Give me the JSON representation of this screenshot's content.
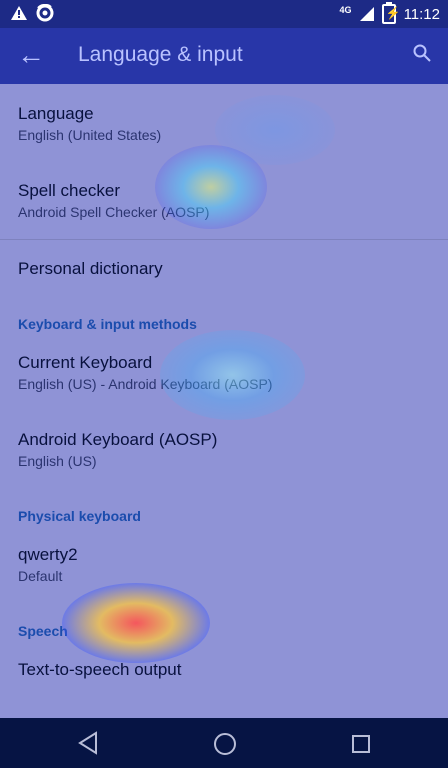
{
  "status_bar": {
    "time": "11:12",
    "network": "4G",
    "icons": [
      "warning-icon",
      "firefox-icon",
      "signal-icon",
      "battery-charging-icon"
    ]
  },
  "app_bar": {
    "title": "Language & input",
    "back_icon": "arrow-back-icon",
    "search_icon": "search-icon"
  },
  "items": {
    "language": {
      "title": "Language",
      "summary": "English (United States)"
    },
    "spell_checker": {
      "title": "Spell checker",
      "summary": "Android Spell Checker (AOSP)"
    },
    "personal_dictionary": {
      "title": "Personal dictionary"
    },
    "current_keyboard": {
      "title": "Current Keyboard",
      "summary": "English (US) - Android Keyboard (AOSP)"
    },
    "android_keyboard": {
      "title": "Android Keyboard (AOSP)",
      "summary": "English (US)"
    },
    "physical_keyboard": {
      "title": "qwerty2",
      "summary": "Default"
    },
    "tts": {
      "title": "Text-to-speech output"
    }
  },
  "sections": {
    "keyboard_input": "Keyboard & input methods",
    "physical": "Physical keyboard",
    "speech": "Speech"
  },
  "nav_bar": {
    "icons": [
      "nav-back-icon",
      "nav-home-icon",
      "nav-recents-icon"
    ]
  },
  "colors": {
    "status_bar": "#1d2a86",
    "app_bar": "#2836a8",
    "section_header": "#1b4cad",
    "background": "#8f93d6"
  }
}
